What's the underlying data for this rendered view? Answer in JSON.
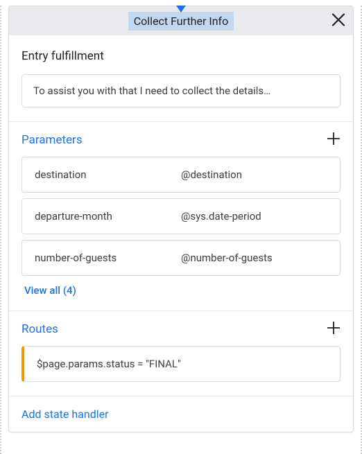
{
  "header": {
    "title": "Collect Further Info"
  },
  "entry_fulfillment": {
    "title": "Entry fulfillment",
    "text": "To assist you with that I need to collect the details…"
  },
  "parameters": {
    "title": "Parameters",
    "items": [
      {
        "name": "destination",
        "entity": "@destination"
      },
      {
        "name": "departure-month",
        "entity": "@sys.date-period"
      },
      {
        "name": "number-of-guests",
        "entity": "@number-of-guests"
      }
    ],
    "view_all_label": "View all (4)"
  },
  "routes": {
    "title": "Routes",
    "items": [
      {
        "condition": "$page.params.status = \"FINAL\""
      }
    ]
  },
  "add_handler_label": "Add state handler"
}
